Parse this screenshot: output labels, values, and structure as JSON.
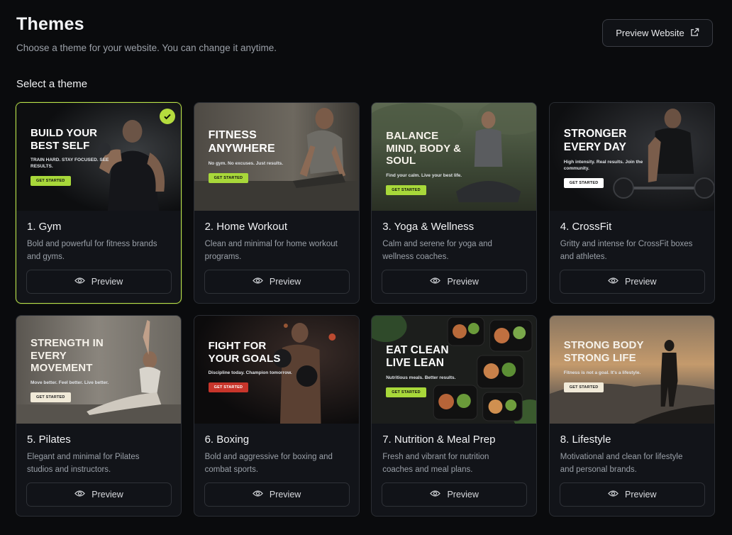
{
  "header": {
    "title": "Themes",
    "subtitle": "Choose a theme for your website. You can change it anytime.",
    "preview_website_label": "Preview Website"
  },
  "section_label": "Select a theme",
  "preview_label": "Preview",
  "colors": {
    "accent": "#b5dc3e",
    "background": "#0a0b0d",
    "card": "#121419"
  },
  "themes": [
    {
      "title": "1. Gym",
      "description": "Bold and powerful for fitness brands and gyms.",
      "hero": "BUILD YOUR BEST SELF",
      "tagline": "TRAIN HARD. STAY FOCUSED. SEE RESULTS.",
      "cta": "GET STARTED",
      "selected": true
    },
    {
      "title": "2. Home Workout",
      "description": "Clean and minimal for home workout programs.",
      "hero": "FITNESS ANYWHERE",
      "tagline": "No gym. No excuses. Just results.",
      "cta": "GET STARTED",
      "selected": false
    },
    {
      "title": "3. Yoga & Wellness",
      "description": "Calm and serene for yoga and wellness coaches.",
      "hero": "BALANCE MIND, BODY & SOUL",
      "tagline": "Find your calm. Live your best life.",
      "cta": "GET STARTED",
      "selected": false
    },
    {
      "title": "4. CrossFit",
      "description": "Gritty and intense for CrossFit boxes and athletes.",
      "hero": "STRONGER EVERY DAY",
      "tagline": "High intensity. Real results. Join the community.",
      "cta": "GET STARTED",
      "selected": false
    },
    {
      "title": "5. Pilates",
      "description": "Elegant and minimal for Pilates studios and instructors.",
      "hero": "STRENGTH IN EVERY MOVEMENT",
      "tagline": "Move better. Feel better. Live better.",
      "cta": "GET STARTED",
      "selected": false
    },
    {
      "title": "6. Boxing",
      "description": "Bold and aggressive for boxing and combat sports.",
      "hero": "FIGHT FOR YOUR GOALS",
      "tagline": "Discipline today. Champion tomorrow.",
      "cta": "GET STARTED",
      "selected": false
    },
    {
      "title": "7. Nutrition & Meal Prep",
      "description": "Fresh and vibrant for nutrition coaches and meal plans.",
      "hero": "EAT CLEAN LIVE LEAN",
      "tagline": "Nutritious meals. Better results.",
      "cta": "GET STARTED",
      "selected": false
    },
    {
      "title": "8. Lifestyle",
      "description": "Motivational and clean for lifestyle and personal brands.",
      "hero": "STRONG BODY STRONG LIFE",
      "tagline": "Fitness is not a goal. It's a lifestyle.",
      "cta": "GET STARTED",
      "selected": false
    }
  ]
}
